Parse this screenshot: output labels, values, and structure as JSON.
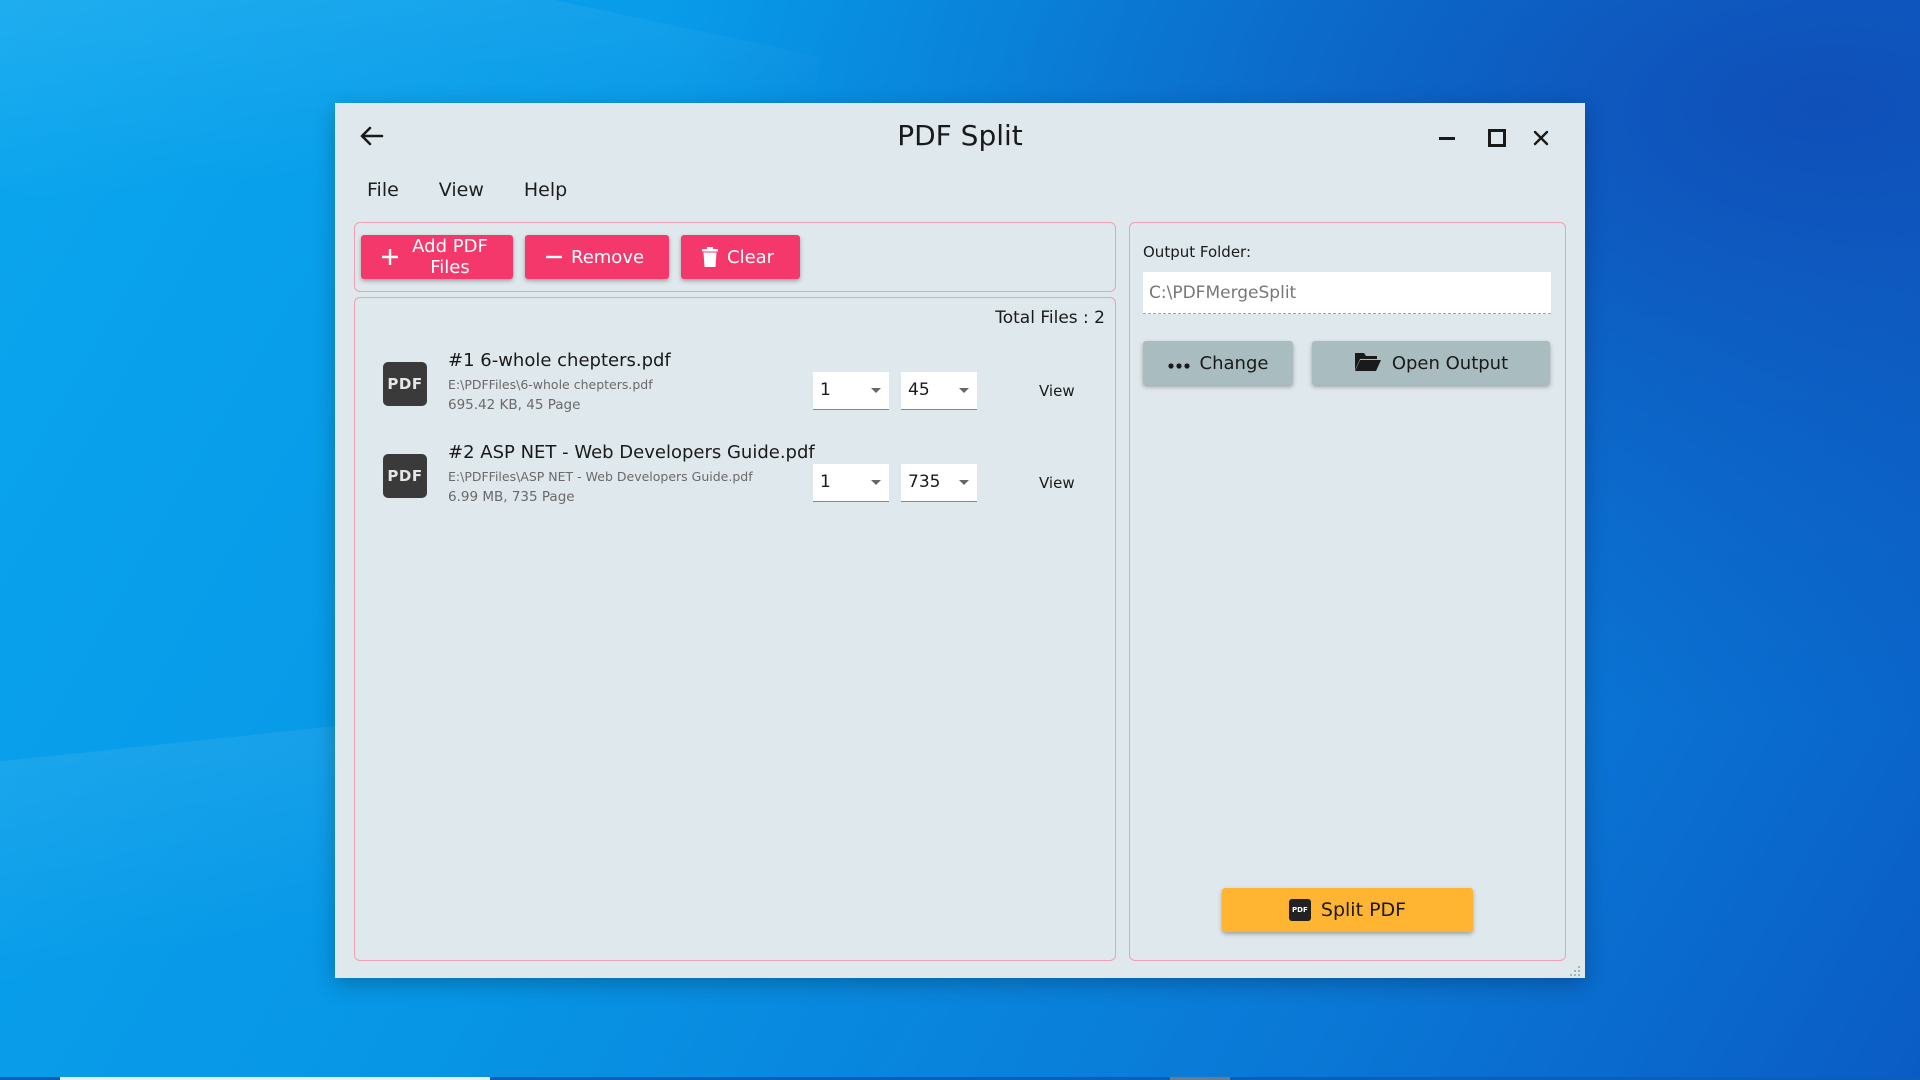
{
  "window": {
    "title": "PDF Split"
  },
  "menu": [
    "File",
    "View",
    "Help"
  ],
  "toolbar": {
    "add_label": "Add PDF Files",
    "remove_label": "Remove",
    "clear_label": "Clear"
  },
  "file_list": {
    "total_label": "Total Files : 2",
    "files": [
      {
        "name": "#1 6-whole chepters.pdf",
        "path": "E:\\PDFFiles\\6-whole chepters.pdf",
        "meta": "695.42 KB, 45 Page",
        "from_page": "1",
        "to_page": "45",
        "view_label": "View"
      },
      {
        "name": "#2 ASP NET - Web Developers Guide.pdf",
        "path": "E:\\PDFFiles\\ASP NET - Web Developers Guide.pdf",
        "meta": "6.99 MB, 735 Page",
        "from_page": "1",
        "to_page": "735",
        "view_label": "View"
      }
    ],
    "icon_text": "PDF"
  },
  "output": {
    "label": "Output Folder:",
    "path": "C:\\PDFMergeSplit",
    "change_label": "Change",
    "open_label": "Open Output"
  },
  "split": {
    "label": "Split PDF",
    "icon_text": "PDF"
  },
  "colors": {
    "accent_pink": "#f5386b",
    "accent_orange": "#ffb531",
    "grey_button": "#a9bcc0",
    "window_bg": "#dfe8ec"
  }
}
